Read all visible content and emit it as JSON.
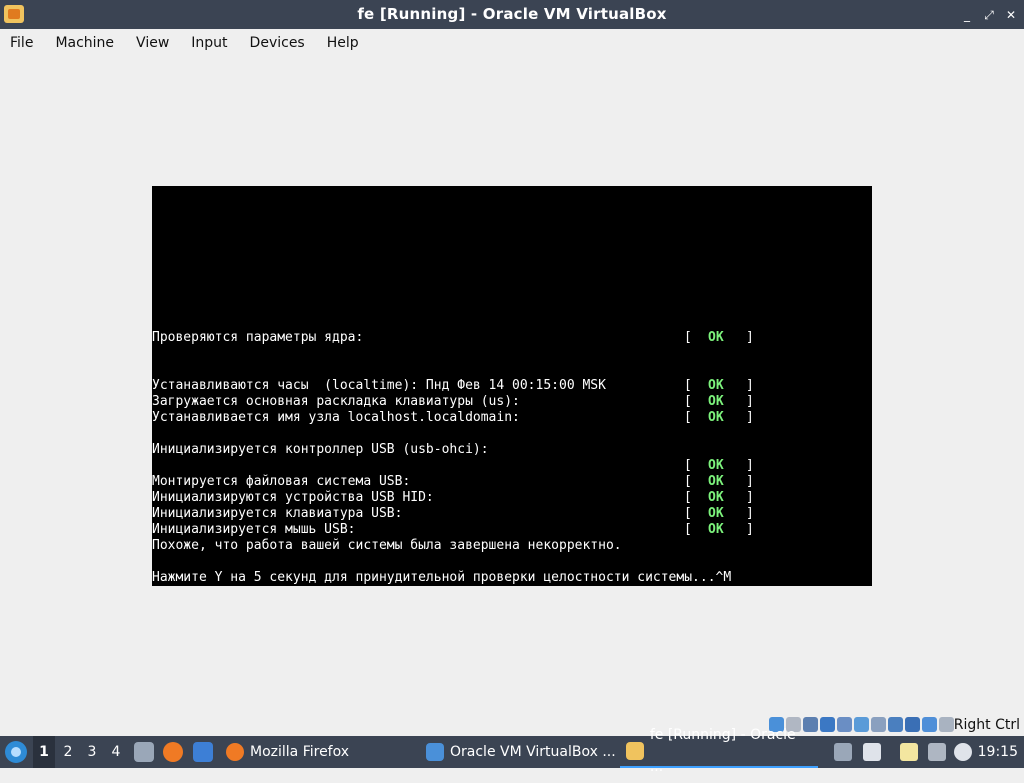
{
  "window": {
    "title": "fe [Running] - Oracle VM VirtualBox",
    "controls": [
      "_",
      "⤢",
      "✕"
    ]
  },
  "menu": [
    "File",
    "Machine",
    "View",
    "Input",
    "Devices",
    "Help"
  ],
  "console": {
    "lines": [
      {
        "text": "Проверяются параметры ядра:",
        "status": "OK"
      },
      {
        "text": "",
        "status": null
      },
      {
        "text": "",
        "status": null
      },
      {
        "text": "Устанавливаются часы  (localtime): Пнд Фев 14 00:15:00 MSK",
        "status": "OK"
      },
      {
        "text": "Загружается основная раскладка клавиатуры (us):",
        "status": "OK"
      },
      {
        "text": "Устанавливается имя узла localhost.localdomain:",
        "status": "OK"
      },
      {
        "text": "",
        "status": null
      },
      {
        "text": "Инициализируется контроллер USB (usb-ohci):",
        "status": null
      },
      {
        "text": "",
        "status": "OK"
      },
      {
        "text": "Монтируется файловая система USB:",
        "status": "OK"
      },
      {
        "text": "Инициализируются устройства USB HID:",
        "status": "OK"
      },
      {
        "text": "Инициализируется клавиатура USB:",
        "status": "OK"
      },
      {
        "text": "Инициализируется мышь USB:",
        "status": "OK"
      },
      {
        "text": "Похоже, что работа вашей системы была завершена некорректно.",
        "status": null
      },
      {
        "text": "",
        "status": null
      },
      {
        "text": "Нажмите Y на 5 секунд для принудительной проверки целостности системы...^M",
        "status": null
      }
    ]
  },
  "statusbar": {
    "icons": [
      "hard-disk-icon",
      "optical-drive-icon",
      "audio-icon",
      "network-icon",
      "usb-icon",
      "shared-folders-icon",
      "display-icon",
      "video-capture-icon",
      "virtualization-icon",
      "mouse-integration-icon",
      "keyboard-icon"
    ],
    "host_key": "Right Ctrl"
  },
  "taskbar": {
    "workspaces": [
      "1",
      "2",
      "3",
      "4"
    ],
    "active_workspace": "1",
    "tasks": [
      {
        "label": "Mozilla Firefox",
        "icon": "firefox-icon"
      },
      {
        "label": "Oracle VM VirtualBox ...",
        "icon": "virtualbox-icon"
      },
      {
        "label": "fe [Running] - Oracle ...",
        "icon": "vm-icon"
      }
    ],
    "clock": "19:15"
  },
  "colors": {
    "titlebar": "#3b4453",
    "ok_green": "#7cf27c",
    "screen": "#000000"
  }
}
